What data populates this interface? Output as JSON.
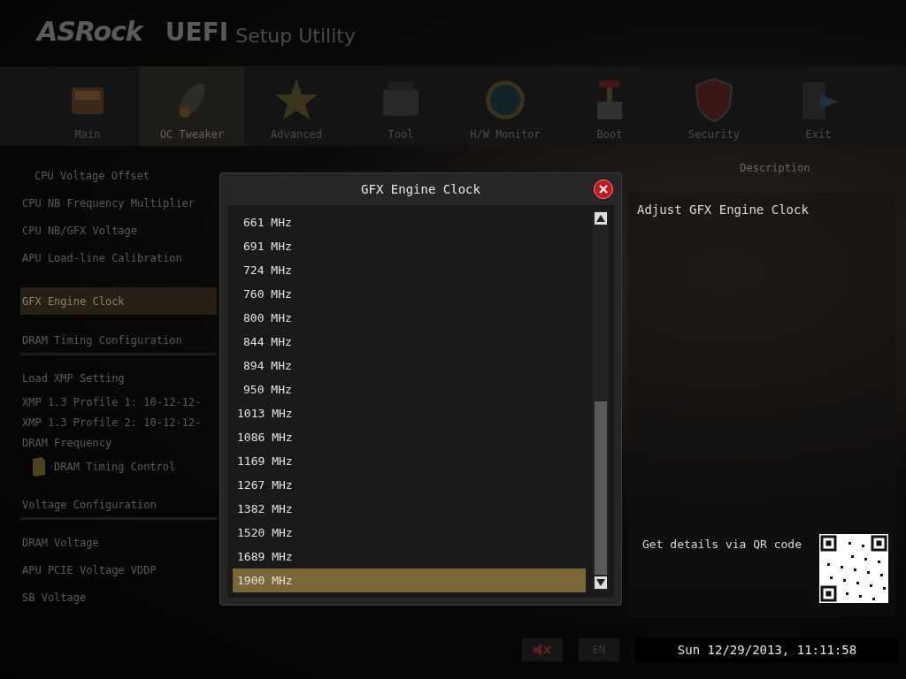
{
  "header": {
    "logo": "ASRock",
    "title": "UEFI",
    "subtitle": "Setup Utility"
  },
  "tabs": [
    {
      "label": "Main",
      "selected": false
    },
    {
      "label": "OC Tweaker",
      "selected": true
    },
    {
      "label": "Advanced",
      "selected": false
    },
    {
      "label": "Tool",
      "selected": false
    },
    {
      "label": "H/W Monitor",
      "selected": false
    },
    {
      "label": "Boot",
      "selected": false
    },
    {
      "label": "Security",
      "selected": false
    },
    {
      "label": "Exit",
      "selected": false
    }
  ],
  "menu": [
    {
      "kind": "item",
      "label": "CPU Voltage Offset",
      "selected": false
    },
    {
      "kind": "item",
      "label": "CPU NB Frequency Multiplier",
      "selected": false
    },
    {
      "kind": "item",
      "label": "CPU NB/GFX Voltage",
      "selected": false
    },
    {
      "kind": "item",
      "label": "APU Load-line Calibration",
      "selected": false
    },
    {
      "kind": "item",
      "label": "GFX Engine Clock",
      "selected": true
    },
    {
      "kind": "section",
      "label": "DRAM Timing Configuration",
      "selected": false
    },
    {
      "kind": "item",
      "label": "Load XMP Setting",
      "selected": false
    },
    {
      "kind": "item",
      "label": "XMP 1.3 Profile 1: 10-12-12-",
      "selected": false
    },
    {
      "kind": "item",
      "label": "XMP 1.3 Profile 2: 10-12-12-",
      "selected": false
    },
    {
      "kind": "item",
      "label": "DRAM Frequency",
      "selected": false
    },
    {
      "kind": "folder",
      "label": "DRAM Timing Control",
      "selected": false
    },
    {
      "kind": "section",
      "label": "Voltage Configuration",
      "selected": false
    },
    {
      "kind": "item",
      "label": "DRAM Voltage",
      "selected": false
    },
    {
      "kind": "item",
      "label": "APU PCIE Voltage VDDP",
      "selected": false
    },
    {
      "kind": "item",
      "label": "SB Voltage",
      "selected": false
    }
  ],
  "dialog": {
    "title": "GFX Engine Clock",
    "options": [
      {
        "label": "661 MHz",
        "selected": false
      },
      {
        "label": "691 MHz",
        "selected": false
      },
      {
        "label": "724 MHz",
        "selected": false
      },
      {
        "label": "760 MHz",
        "selected": false
      },
      {
        "label": "800 MHz",
        "selected": false
      },
      {
        "label": "844 MHz",
        "selected": false
      },
      {
        "label": "894 MHz",
        "selected": false
      },
      {
        "label": "950 MHz",
        "selected": false
      },
      {
        "label": "1013 MHz",
        "selected": false
      },
      {
        "label": "1086 MHz",
        "selected": false
      },
      {
        "label": "1169 MHz",
        "selected": false
      },
      {
        "label": "1267 MHz",
        "selected": false
      },
      {
        "label": "1382 MHz",
        "selected": false
      },
      {
        "label": "1520 MHz",
        "selected": false
      },
      {
        "label": "1689 MHz",
        "selected": false
      },
      {
        "label": "1900 MHz",
        "selected": true
      }
    ]
  },
  "description": {
    "heading": "Description",
    "text": "Adjust GFX Engine Clock",
    "qr_label": "Get details via QR code"
  },
  "status_bar": {
    "language": "EN",
    "datetime": "Sun 12/29/2013, 11:11:58"
  }
}
